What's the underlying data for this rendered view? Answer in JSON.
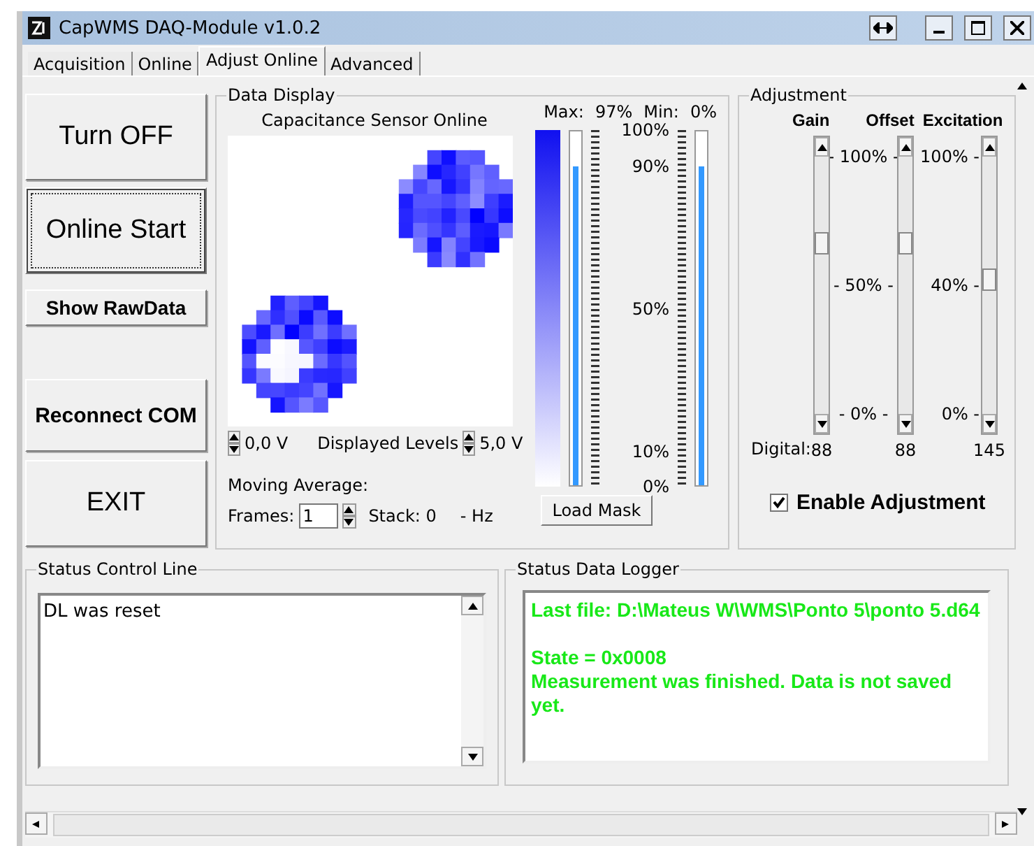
{
  "window": {
    "title": "CapWMS DAQ-Module v1.0.2"
  },
  "tabs": [
    {
      "label": "Acquisition",
      "selected": false
    },
    {
      "label": "Online",
      "selected": false
    },
    {
      "label": "Adjust Online",
      "selected": true
    },
    {
      "label": "Advanced",
      "selected": false
    }
  ],
  "side_buttons": [
    {
      "label": "Turn OFF",
      "kind": "large",
      "focused": false
    },
    {
      "label": "Online Start",
      "kind": "large",
      "focused": true
    },
    {
      "label": "Show RawData",
      "kind": "small",
      "focused": false
    },
    {
      "label": "Reconnect COM",
      "kind": "medium",
      "focused": false
    },
    {
      "label": "EXIT",
      "kind": "large",
      "focused": false
    }
  ],
  "data_display": {
    "title": "Data Display",
    "heading": "Capacitance Sensor Online",
    "max_label": "Max:",
    "max_value": "97%",
    "min_label": "Min:",
    "min_value": "0%",
    "low_voltage": "0,0 V",
    "levels_label": "Displayed Levels",
    "high_voltage": "5,0 V",
    "moving_average_label": "Moving Average:",
    "frames_label": "Frames:",
    "frames_value": "1",
    "stack_label": "Stack: 0",
    "rate": "- Hz",
    "scale_labels": [
      "100%",
      "90%",
      "50%",
      "10%",
      "0%"
    ],
    "meters": [
      {
        "level": 0.9
      },
      {
        "level": 0.9
      }
    ],
    "load_mask_button": "Load Mask"
  },
  "adjustment": {
    "title": "Adjustment",
    "digital_label": "Digital:",
    "sliders": [
      {
        "name": "Gain",
        "level": 0.64,
        "digital": "88"
      },
      {
        "name": "Offset",
        "level": 0.64,
        "digital": "88"
      },
      {
        "name": "Excitation",
        "level": 0.52,
        "digital": "145"
      }
    ],
    "gain_offset_scale": [
      "- 100% -",
      "- 50% -",
      "- 0% -"
    ],
    "excitation_scale": [
      "100% -",
      "40% -",
      "0% -"
    ],
    "enable": {
      "label": "Enable Adjustment",
      "checked": true
    }
  },
  "status_control": {
    "title": "Status Control Line",
    "text": "DL was reset"
  },
  "status_logger": {
    "title": "Status Data Logger",
    "blocks": [
      [
        "Last file: D:\\Mateus W\\WMS\\Ponto 5\\ponto 5.d64"
      ],
      [
        "State = 0x0008",
        "Measurement was finished. Data is not saved yet."
      ]
    ]
  }
}
